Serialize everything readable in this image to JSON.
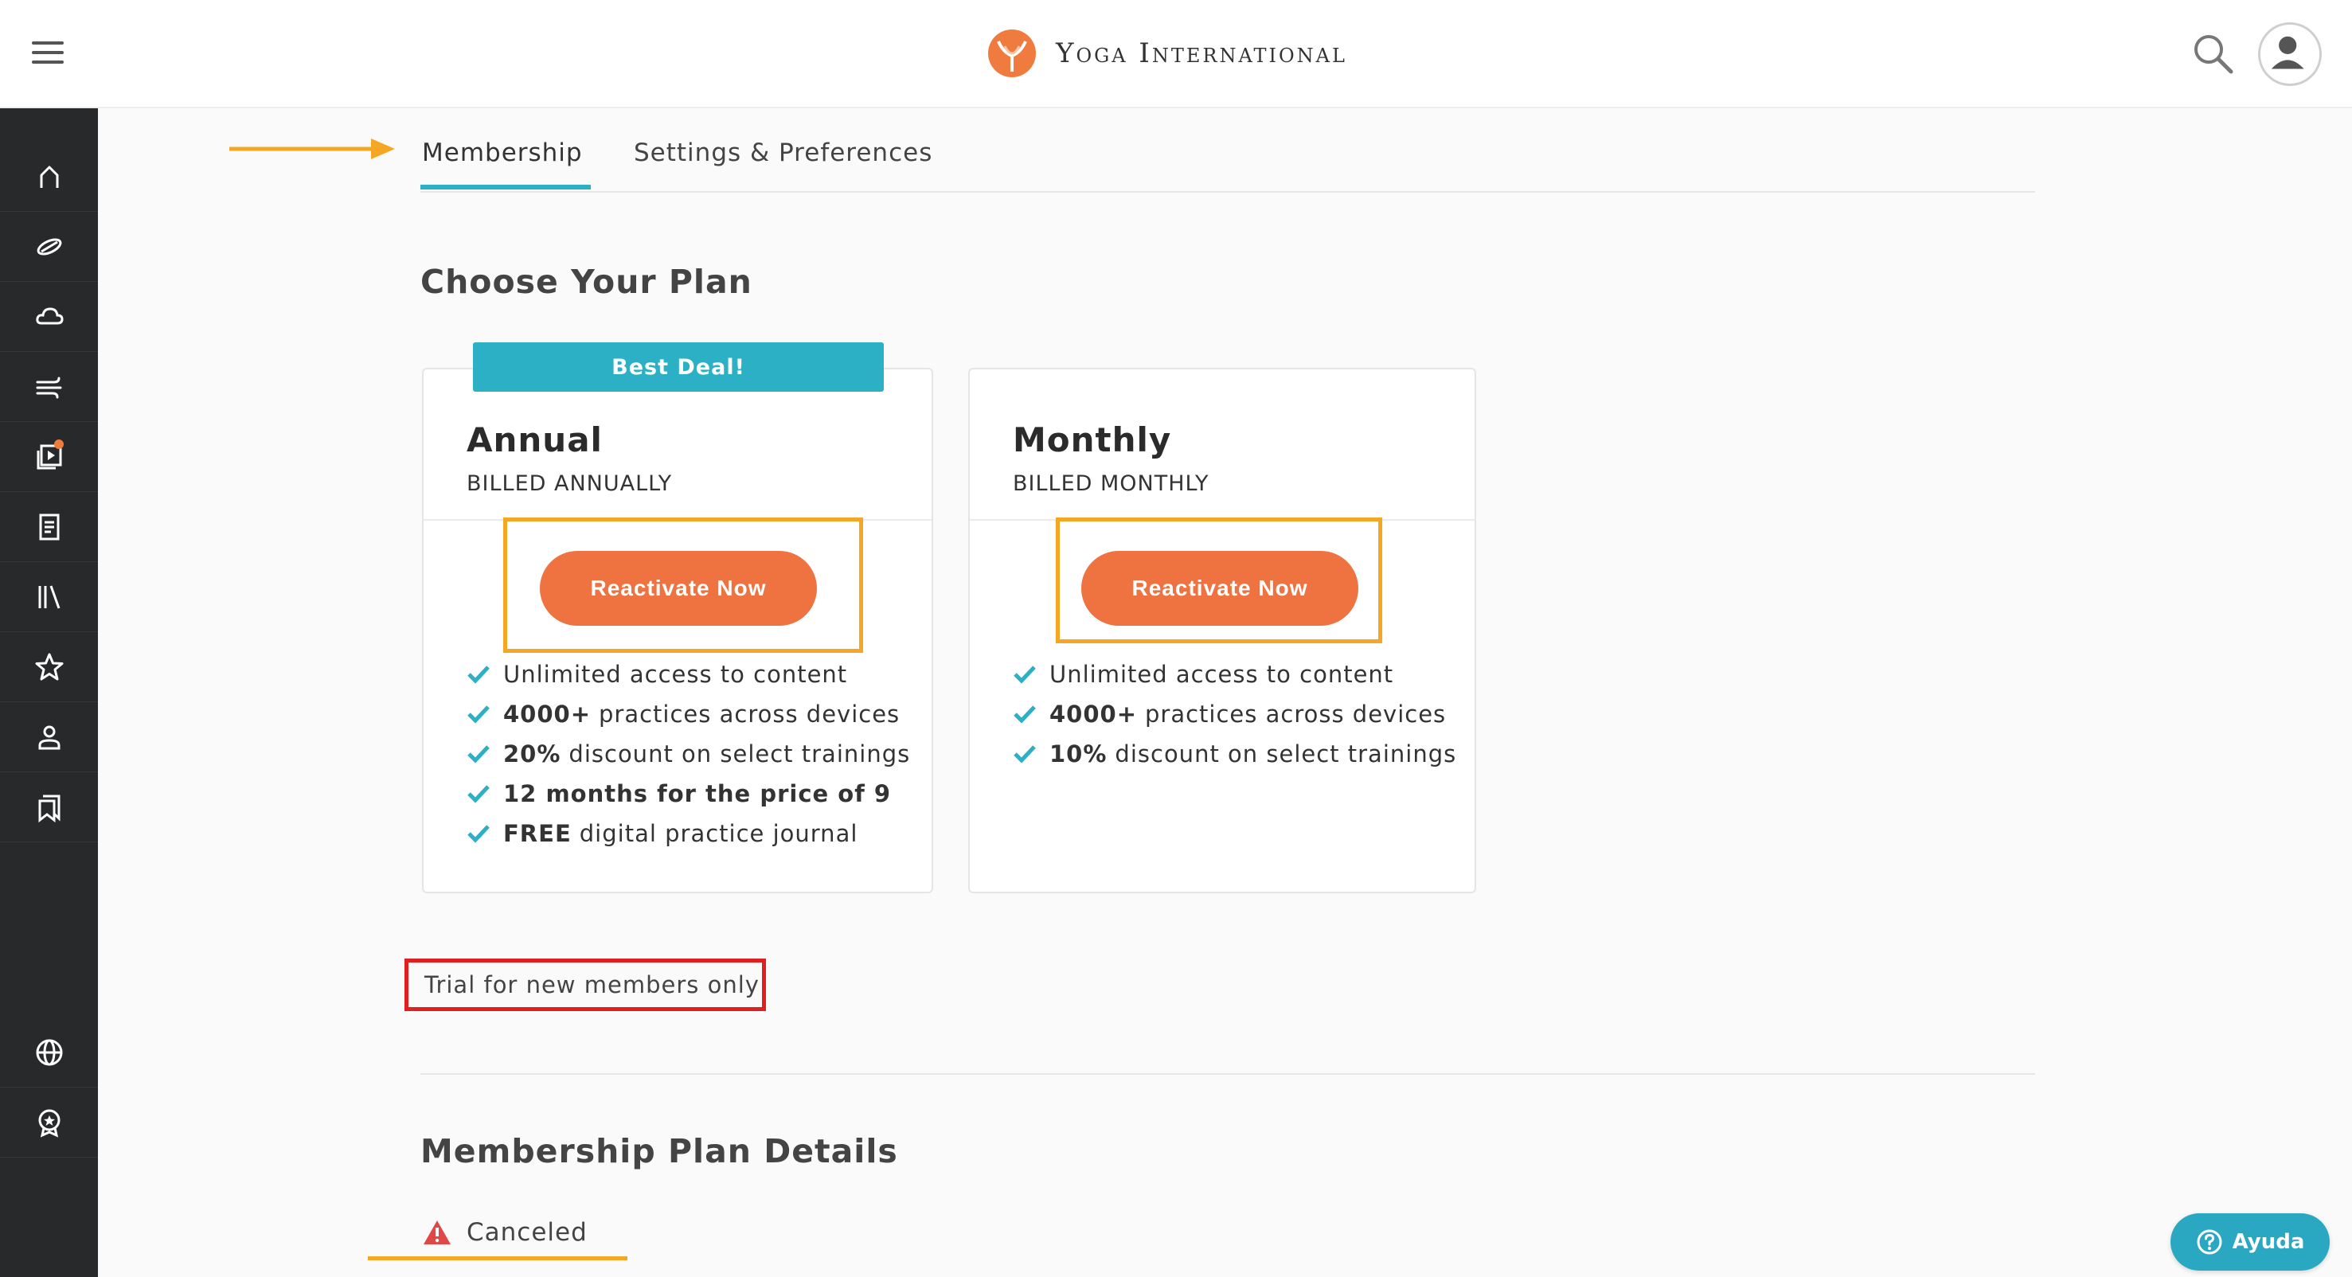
{
  "header": {
    "brand_name": "Yoga International",
    "menu_icon": "hamburger-icon",
    "search_icon": "search-icon",
    "avatar_icon": "user-avatar-icon"
  },
  "sidebar": {
    "items": [
      {
        "icon": "home-icon"
      },
      {
        "icon": "yoga-practice-icon"
      },
      {
        "icon": "cloud-icon"
      },
      {
        "icon": "breath-wind-icon"
      },
      {
        "icon": "video-playlist-icon",
        "has_notification": true
      },
      {
        "icon": "article-icon"
      },
      {
        "icon": "library-icon"
      },
      {
        "icon": "star-icon"
      },
      {
        "icon": "teacher-icon"
      },
      {
        "icon": "bookmark-icon"
      },
      {
        "icon": "globe-icon"
      },
      {
        "icon": "badge-icon"
      }
    ]
  },
  "tabs": [
    {
      "label": "Membership",
      "active": true
    },
    {
      "label": "Settings & Preferences",
      "active": false
    }
  ],
  "plans_section": {
    "title": "Choose Your Plan",
    "plans": [
      {
        "ribbon": "Best Deal!",
        "name": "Annual",
        "billing": "BILLED ANNUALLY",
        "button_label": "Reactivate Now",
        "features": [
          {
            "bold": "",
            "text": "Unlimited access to content"
          },
          {
            "bold": "4000+",
            "text": "practices across devices"
          },
          {
            "bold": "20%",
            "text": "discount on select trainings"
          },
          {
            "bold": "12 months for the price of 9",
            "text": ""
          },
          {
            "bold": "FREE",
            "text": "digital practice journal"
          }
        ]
      },
      {
        "name": "Monthly",
        "billing": "BILLED MONTHLY",
        "button_label": "Reactivate Now",
        "features": [
          {
            "bold": "",
            "text": "Unlimited access to content"
          },
          {
            "bold": "4000+",
            "text": "practices across devices"
          },
          {
            "bold": "10%",
            "text": "discount on select trainings"
          }
        ]
      }
    ],
    "trial_note": "Trial for new members only"
  },
  "details_section": {
    "title": "Membership Plan Details",
    "status": "Canceled",
    "status_icon": "warning-icon"
  },
  "help_button": {
    "label": "Ayuda",
    "icon": "help-circle-icon"
  },
  "colors": {
    "accent_teal": "#2bb0c5",
    "cta_orange": "#ef7340",
    "sidebar_bg": "#27292b",
    "annotation_orange": "#f5a623",
    "annotation_red": "#e02020"
  }
}
